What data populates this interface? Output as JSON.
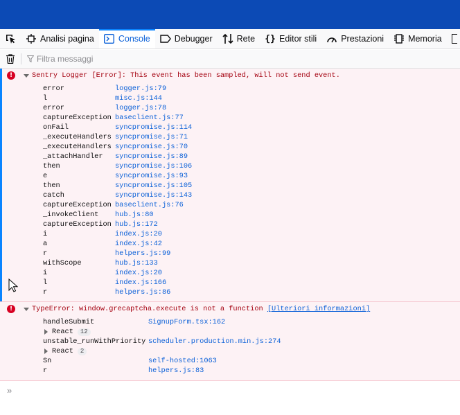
{
  "toolbar": {
    "tabs": [
      {
        "label": "Analisi pagina",
        "icon": "inspector-icon",
        "selected": false
      },
      {
        "label": "Console",
        "icon": "console-icon",
        "selected": true
      },
      {
        "label": "Debugger",
        "icon": "debugger-icon",
        "selected": false
      },
      {
        "label": "Rete",
        "icon": "network-icon",
        "selected": false
      },
      {
        "label": "Editor stili",
        "icon": "style-editor-icon",
        "selected": false
      },
      {
        "label": "Prestazioni",
        "icon": "performance-icon",
        "selected": false
      },
      {
        "label": "Memoria",
        "icon": "memory-icon",
        "selected": false
      }
    ]
  },
  "filter": {
    "placeholder": "Filtra messaggi"
  },
  "messages": [
    {
      "text": "Sentry Logger [Error]: This event has been sampled, will not send event.",
      "frames": [
        {
          "fn": "error",
          "loc": "logger.js:79"
        },
        {
          "fn": "l",
          "loc": "misc.js:144"
        },
        {
          "fn": "error",
          "loc": "logger.js:78"
        },
        {
          "fn": "captureException",
          "loc": "baseclient.js:77"
        },
        {
          "fn": "onFail",
          "loc": "syncpromise.js:114"
        },
        {
          "fn": "_executeHandlers",
          "loc": "syncpromise.js:71"
        },
        {
          "fn": "_executeHandlers",
          "loc": "syncpromise.js:70"
        },
        {
          "fn": "_attachHandler",
          "loc": "syncpromise.js:89"
        },
        {
          "fn": "then",
          "loc": "syncpromise.js:106"
        },
        {
          "fn": "e",
          "loc": "syncpromise.js:93"
        },
        {
          "fn": "then",
          "loc": "syncpromise.js:105"
        },
        {
          "fn": "catch",
          "loc": "syncpromise.js:143"
        },
        {
          "fn": "captureException",
          "loc": "baseclient.js:76"
        },
        {
          "fn": "_invokeClient",
          "loc": "hub.js:80"
        },
        {
          "fn": "captureException",
          "loc": "hub.js:172"
        },
        {
          "fn": "i",
          "loc": "index.js:20"
        },
        {
          "fn": "a",
          "loc": "index.js:42"
        },
        {
          "fn": "r",
          "loc": "helpers.js:99"
        },
        {
          "fn": "withScope",
          "loc": "hub.js:133"
        },
        {
          "fn": "i",
          "loc": "index.js:20"
        },
        {
          "fn": "l",
          "loc": "index.js:166"
        },
        {
          "fn": "r",
          "loc": "helpers.js:86"
        }
      ]
    },
    {
      "text": "TypeError: window.grecaptcha.execute is not a function",
      "link": "[Ulteriori informazioni]",
      "frames": [
        {
          "fn": "handleSubmit",
          "loc": "SignupForm.tsx:162"
        },
        {
          "group": "React",
          "count": "12"
        },
        {
          "fn": "unstable_runWithPriority",
          "loc": "scheduler.production.min.js:274"
        },
        {
          "group": "React",
          "count": "2"
        },
        {
          "fn": "Sn",
          "loc": "self-hosted:1063"
        },
        {
          "fn": "r",
          "loc": "helpers.js:83"
        }
      ]
    }
  ],
  "input": {
    "prompt": "»"
  }
}
